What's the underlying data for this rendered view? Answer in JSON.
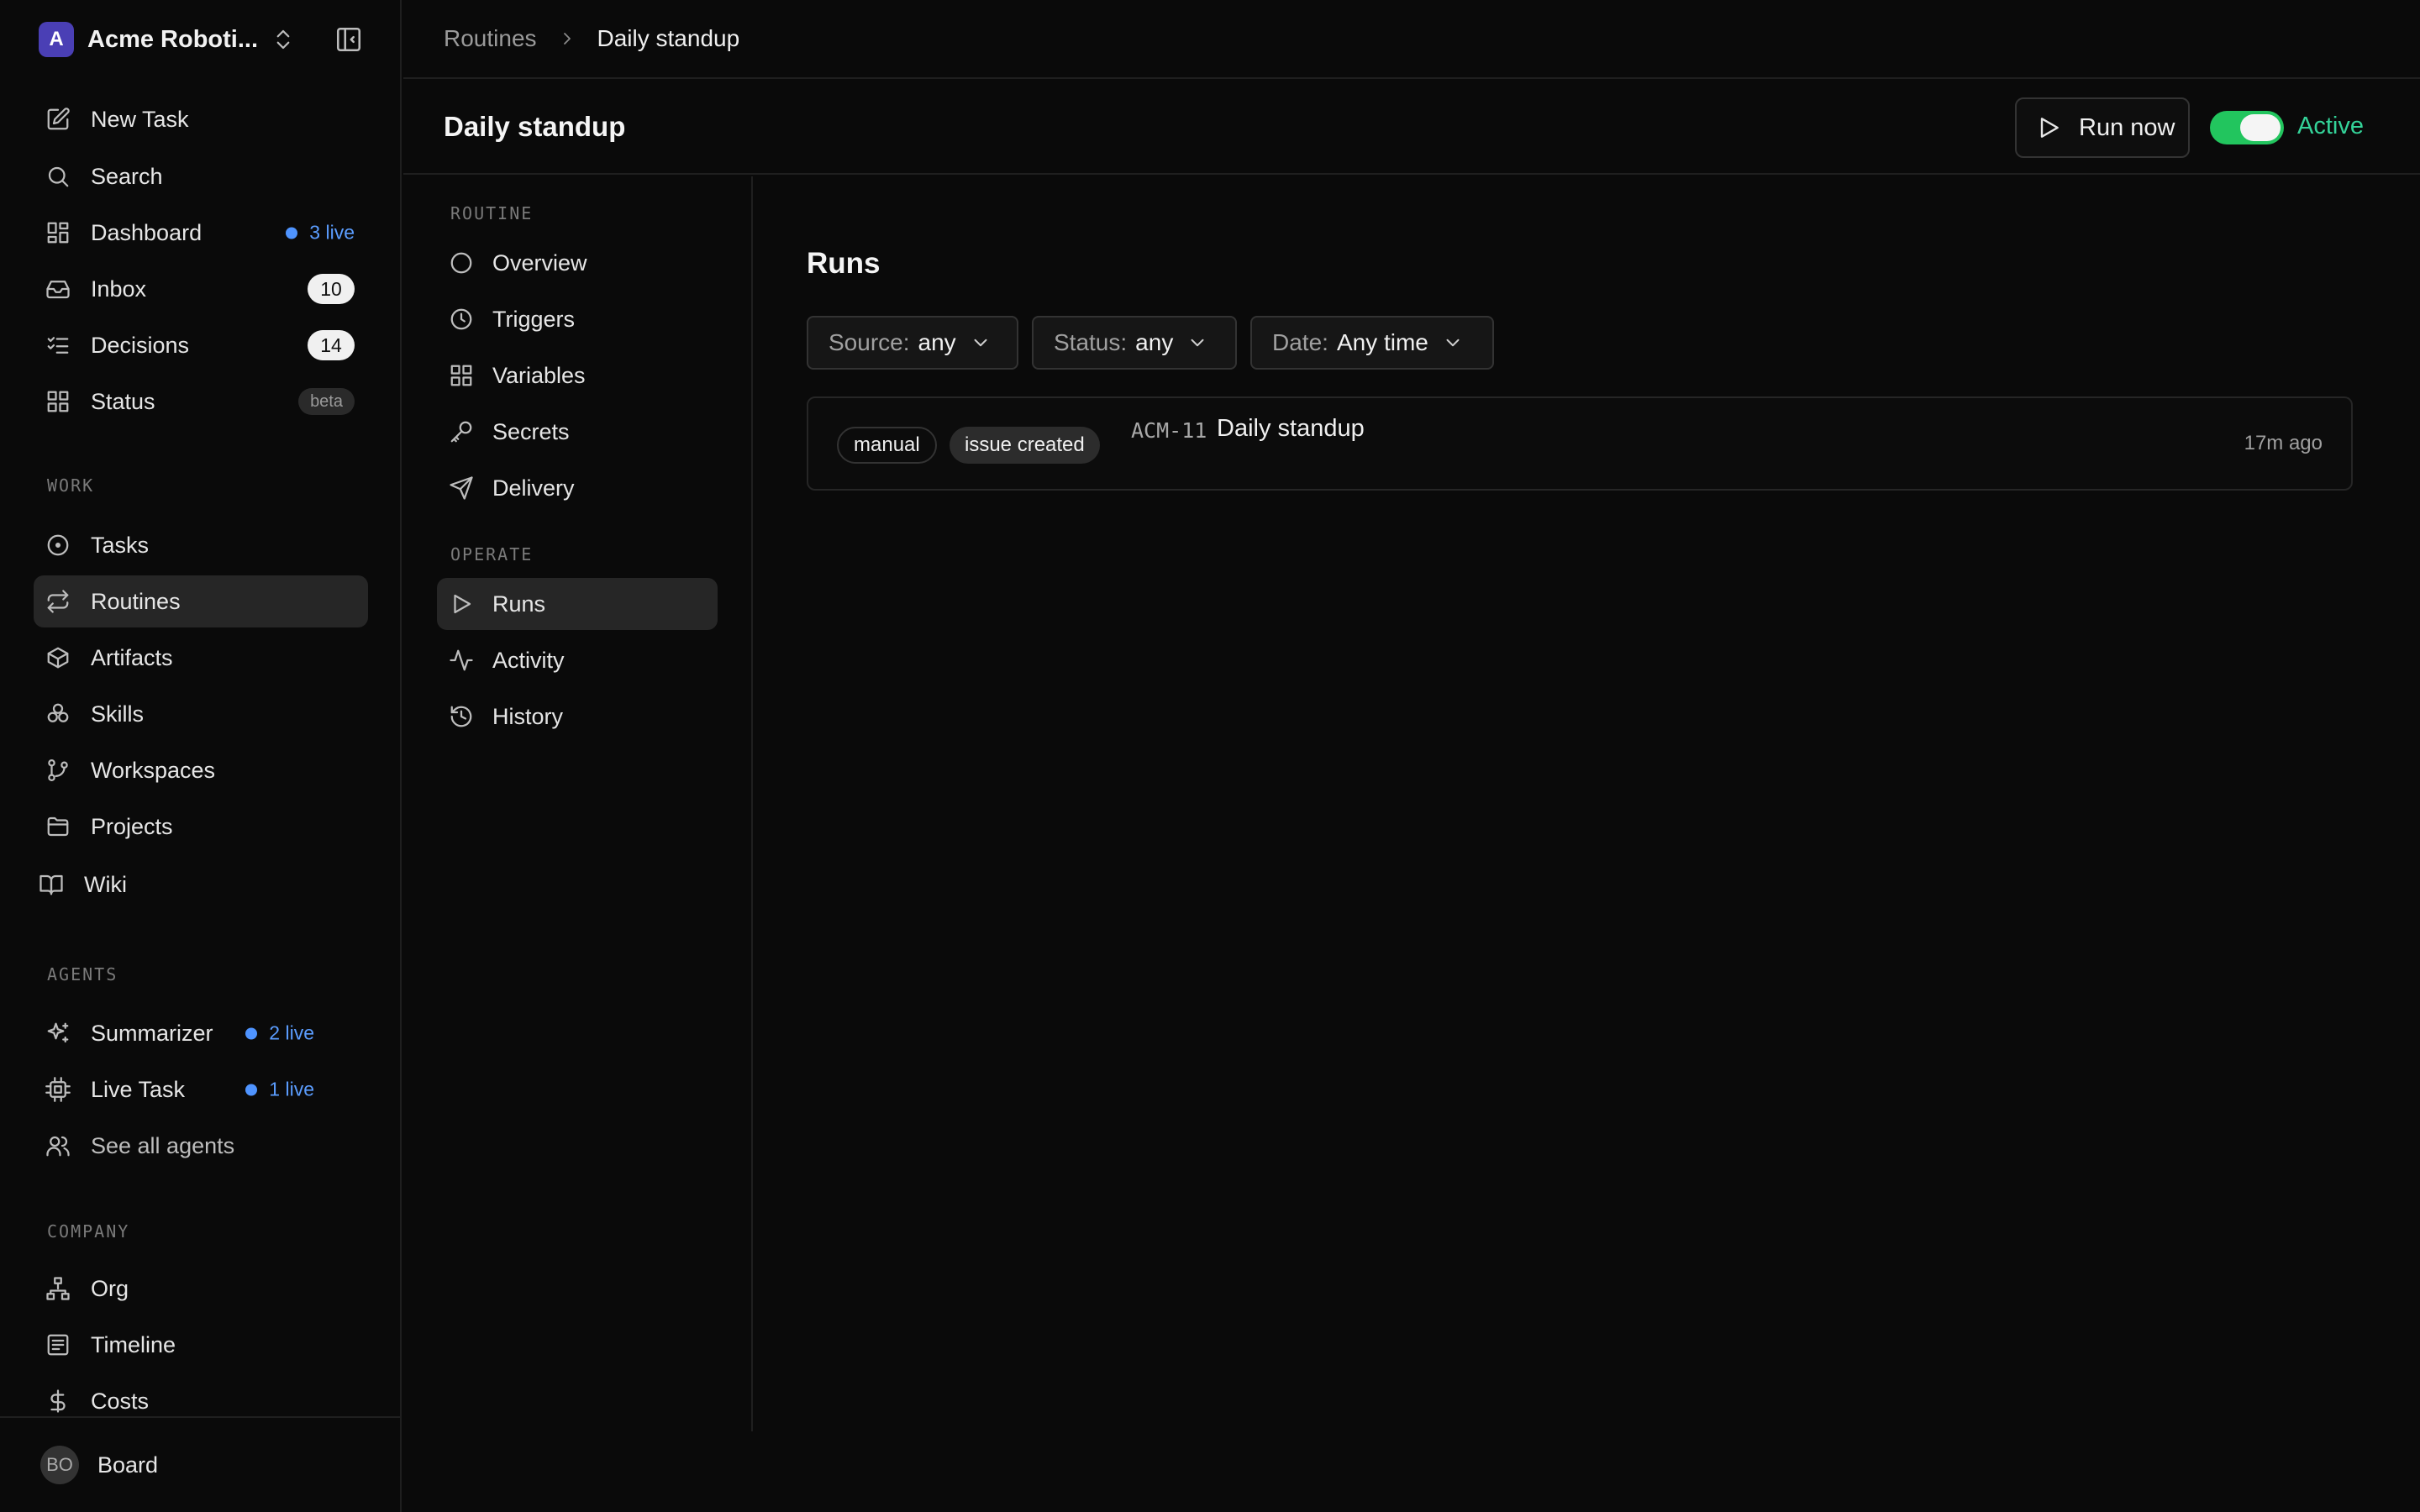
{
  "workspace": {
    "logo_letter": "A",
    "name": "Acme Roboti..."
  },
  "sidebar": {
    "main": [
      {
        "label": "New Task",
        "icon": "edit-icon"
      },
      {
        "label": "Search",
        "icon": "search-icon"
      },
      {
        "label": "Dashboard",
        "icon": "dashboard-icon",
        "live": "3 live"
      },
      {
        "label": "Inbox",
        "icon": "inbox-icon",
        "count": "10"
      },
      {
        "label": "Decisions",
        "icon": "checklist-icon",
        "count": "14"
      },
      {
        "label": "Status",
        "icon": "grid-icon",
        "badge": "beta"
      }
    ],
    "work_label": "WORK",
    "work": [
      {
        "label": "Tasks",
        "icon": "circle-dot-icon"
      },
      {
        "label": "Routines",
        "icon": "repeat-icon"
      },
      {
        "label": "Artifacts",
        "icon": "box-icon"
      },
      {
        "label": "Skills",
        "icon": "boxes-icon"
      },
      {
        "label": "Workspaces",
        "icon": "git-branch-icon"
      },
      {
        "label": "Projects",
        "icon": "folder-icon"
      },
      {
        "label": "Wiki",
        "icon": "book-icon"
      }
    ],
    "agents_label": "AGENTS",
    "agents": [
      {
        "label": "Summarizer",
        "icon": "sparkles-icon",
        "live": "2 live"
      },
      {
        "label": "Live Task",
        "icon": "cpu-icon",
        "live": "1 live"
      },
      {
        "label": "See all agents",
        "icon": "users-icon"
      }
    ],
    "company_label": "COMPANY",
    "company": [
      {
        "label": "Org",
        "icon": "org-chart-icon"
      },
      {
        "label": "Timeline",
        "icon": "timeline-icon"
      },
      {
        "label": "Costs",
        "icon": "dollar-icon"
      }
    ],
    "footer": {
      "avatar": "BO",
      "label": "Board"
    }
  },
  "breadcrumb": {
    "parent": "Routines",
    "current": "Daily standup"
  },
  "header": {
    "title": "Daily standup",
    "run_now": "Run now",
    "status": "Active"
  },
  "subnav": {
    "routine_label": "ROUTINE",
    "routine": [
      {
        "label": "Overview",
        "icon": "circle-icon"
      },
      {
        "label": "Triggers",
        "icon": "clock-icon"
      },
      {
        "label": "Variables",
        "icon": "grid-icon"
      },
      {
        "label": "Secrets",
        "icon": "key-icon"
      },
      {
        "label": "Delivery",
        "icon": "send-icon"
      }
    ],
    "operate_label": "OPERATE",
    "operate": [
      {
        "label": "Runs",
        "icon": "play-icon"
      },
      {
        "label": "Activity",
        "icon": "activity-icon"
      },
      {
        "label": "History",
        "icon": "history-icon"
      }
    ]
  },
  "content": {
    "title": "Runs",
    "filters": [
      {
        "key": "Source:",
        "value": "any"
      },
      {
        "key": "Status:",
        "value": "any"
      },
      {
        "key": "Date:",
        "value": "Any time"
      }
    ],
    "runs": [
      {
        "tags": [
          "manual",
          "issue created"
        ],
        "id": "ACM-11",
        "title": "Daily standup",
        "time": "17m ago"
      }
    ]
  },
  "colors": {
    "accent_green": "#22c55e",
    "live_blue": "#4f94ff",
    "active_text": "#34d399"
  }
}
